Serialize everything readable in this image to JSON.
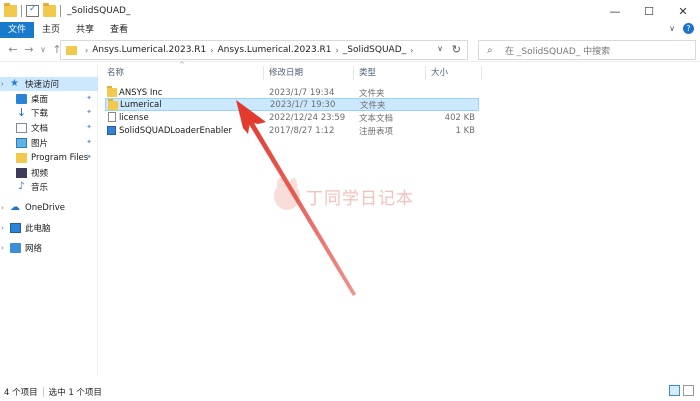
{
  "window": {
    "title": "_SolidSQUAD_",
    "buttons": {
      "minimize": "—",
      "maximize": "☐",
      "close": "✕"
    }
  },
  "ribbon": {
    "tabs": [
      "文件",
      "主页",
      "共享",
      "查看"
    ],
    "active_tab": "文件"
  },
  "navbar": {
    "back": "←",
    "forward": "→",
    "recent": "∨",
    "up": "↑",
    "breadcrumbs": [
      "Ansys.Lumerical.2023.R1",
      "Ansys.Lumerical.2023.R1",
      "_SolidSQUAD_"
    ],
    "crumb_separator": "›",
    "dropdown": "∨",
    "refresh": "↻",
    "search_placeholder": "在 _SolidSQUAD_ 中搜索"
  },
  "sidebar": {
    "items": [
      {
        "label": "快速访问",
        "icon": "star-icon",
        "pinned": false
      },
      {
        "label": "桌面",
        "icon": "desktop-icon",
        "pinned": true
      },
      {
        "label": "下载",
        "icon": "download-icon",
        "pinned": true
      },
      {
        "label": "文档",
        "icon": "document-icon",
        "pinned": true
      },
      {
        "label": "图片",
        "icon": "picture-icon",
        "pinned": true
      },
      {
        "label": "Program Files",
        "icon": "folder-icon",
        "pinned": true
      },
      {
        "label": "视频",
        "icon": "video-icon",
        "pinned": false
      },
      {
        "label": "音乐",
        "icon": "music-icon",
        "pinned": false
      },
      {
        "label": "OneDrive",
        "icon": "cloud-icon",
        "pinned": false
      },
      {
        "label": "此电脑",
        "icon": "computer-icon",
        "pinned": false
      },
      {
        "label": "网络",
        "icon": "network-icon",
        "pinned": false
      }
    ],
    "pin_glyph": "📌",
    "expand_glyph": "›"
  },
  "list": {
    "columns": {
      "name": "名称",
      "date": "修改日期",
      "type": "类型",
      "size": "大小"
    },
    "sort_glyph": "^",
    "rows": [
      {
        "name": "ANSYS Inc",
        "date": "2023/1/7 19:34",
        "type": "文件夹",
        "size": "",
        "icon": "folder-icon",
        "selected": false
      },
      {
        "name": "Lumerical",
        "date": "2023/1/7 19:30",
        "type": "文件夹",
        "size": "",
        "icon": "folder-icon",
        "selected": true
      },
      {
        "name": "license",
        "date": "2022/12/24 23:59",
        "type": "文本文档",
        "size": "402 KB",
        "icon": "text-file-icon",
        "selected": false
      },
      {
        "name": "SolidSQUADLoaderEnabler",
        "date": "2017/8/27 1:12",
        "type": "注册表项",
        "size": "1 KB",
        "icon": "registry-file-icon",
        "selected": false
      }
    ]
  },
  "watermark": {
    "text": "丁同学日记本"
  },
  "annotation": {
    "color": "#e23a2e"
  },
  "status": {
    "item_count": "4 个项目",
    "selected": "选中 1 个项目"
  },
  "colors": {
    "accent": "#1979ca",
    "selection": "#cce8ff"
  }
}
